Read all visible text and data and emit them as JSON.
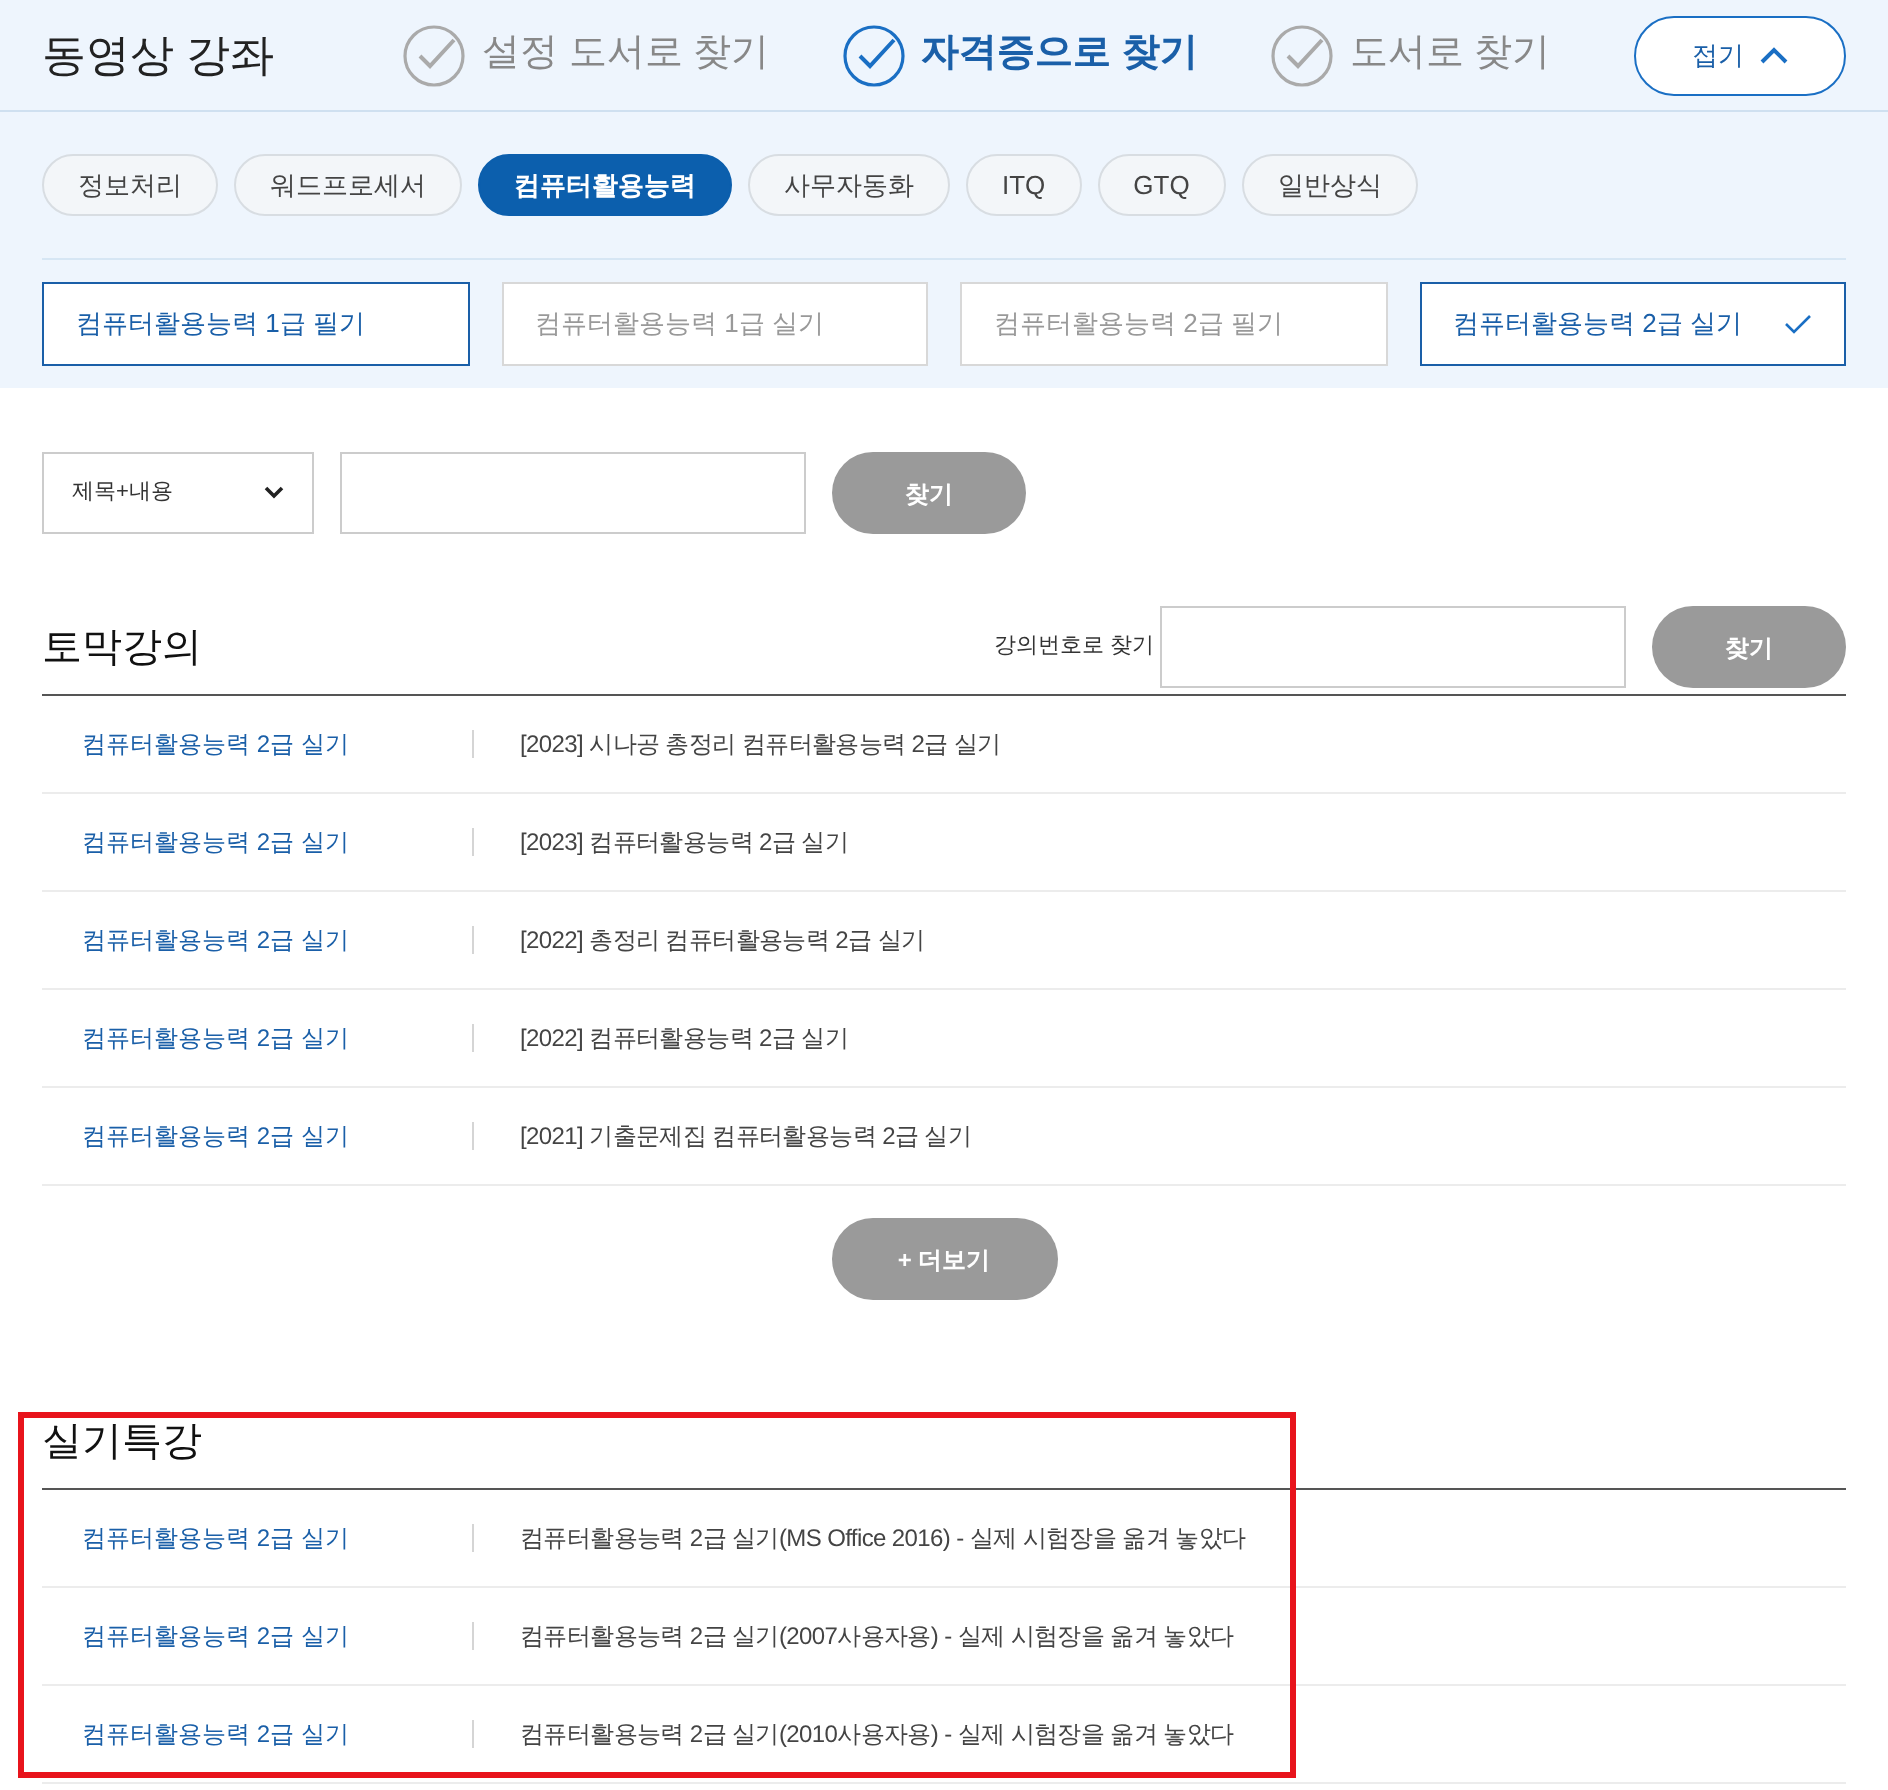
{
  "header": {
    "title": "동영상 강좌",
    "modes": [
      {
        "label": "설정 도서로 찾기",
        "selected": false
      },
      {
        "label": "자격증으로 찾기",
        "selected": true
      },
      {
        "label": "도서로 찾기",
        "selected": false
      }
    ],
    "collapse_button": "접기"
  },
  "categories": [
    {
      "label": "정보처리",
      "selected": false
    },
    {
      "label": "워드프로세서",
      "selected": false
    },
    {
      "label": "컴퓨터활용능력",
      "selected": true
    },
    {
      "label": "사무자동화",
      "selected": false
    },
    {
      "label": "ITQ",
      "selected": false
    },
    {
      "label": "GTQ",
      "selected": false
    },
    {
      "label": "일반상식",
      "selected": false
    }
  ],
  "subjects": [
    {
      "label": "컴퓨터활용능력 1급 필기",
      "checked": false,
      "outlined": true
    },
    {
      "label": "컴퓨터활용능력 1급 실기",
      "checked": false,
      "outlined": false
    },
    {
      "label": "컴퓨터활용능력 2급 필기",
      "checked": false,
      "outlined": false
    },
    {
      "label": "컴퓨터활용능력 2급 실기",
      "checked": true,
      "outlined": true
    }
  ],
  "search": {
    "scope": "제목+내용",
    "button": "찾기"
  },
  "sections": [
    {
      "title": "토막강의",
      "highlighted": false,
      "number_search": {
        "label": "강의번호로 찾기",
        "button": "찾기"
      },
      "rows": [
        {
          "category": "컴퓨터활용능력 2급 실기",
          "title": "[2023] 시나공 총정리 컴퓨터활용능력 2급 실기"
        },
        {
          "category": "컴퓨터활용능력 2급 실기",
          "title": "[2023] 컴퓨터활용능력 2급 실기"
        },
        {
          "category": "컴퓨터활용능력 2급 실기",
          "title": "[2022] 총정리 컴퓨터활용능력 2급 실기"
        },
        {
          "category": "컴퓨터활용능력 2급 실기",
          "title": "[2022] 컴퓨터활용능력 2급 실기"
        },
        {
          "category": "컴퓨터활용능력 2급 실기",
          "title": "[2021] 기출문제집 컴퓨터활용능력 2급 실기"
        }
      ],
      "more_button": "+ 더보기"
    },
    {
      "title": "실기특강",
      "highlighted": true,
      "rows": [
        {
          "category": "컴퓨터활용능력 2급 실기",
          "title": "컴퓨터활용능력 2급 실기(MS Office 2016) - 실제 시험장을 옮겨 놓았다"
        },
        {
          "category": "컴퓨터활용능력 2급 실기",
          "title": "컴퓨터활용능력 2급 실기(2007사용자용) - 실제 시험장을 옮겨 놓았다"
        },
        {
          "category": "컴퓨터활용능력 2급 실기",
          "title": "컴퓨터활용능력 2급 실기(2010사용자용) - 실제 시험장을 옮겨 놓았다"
        }
      ]
    }
  ]
}
